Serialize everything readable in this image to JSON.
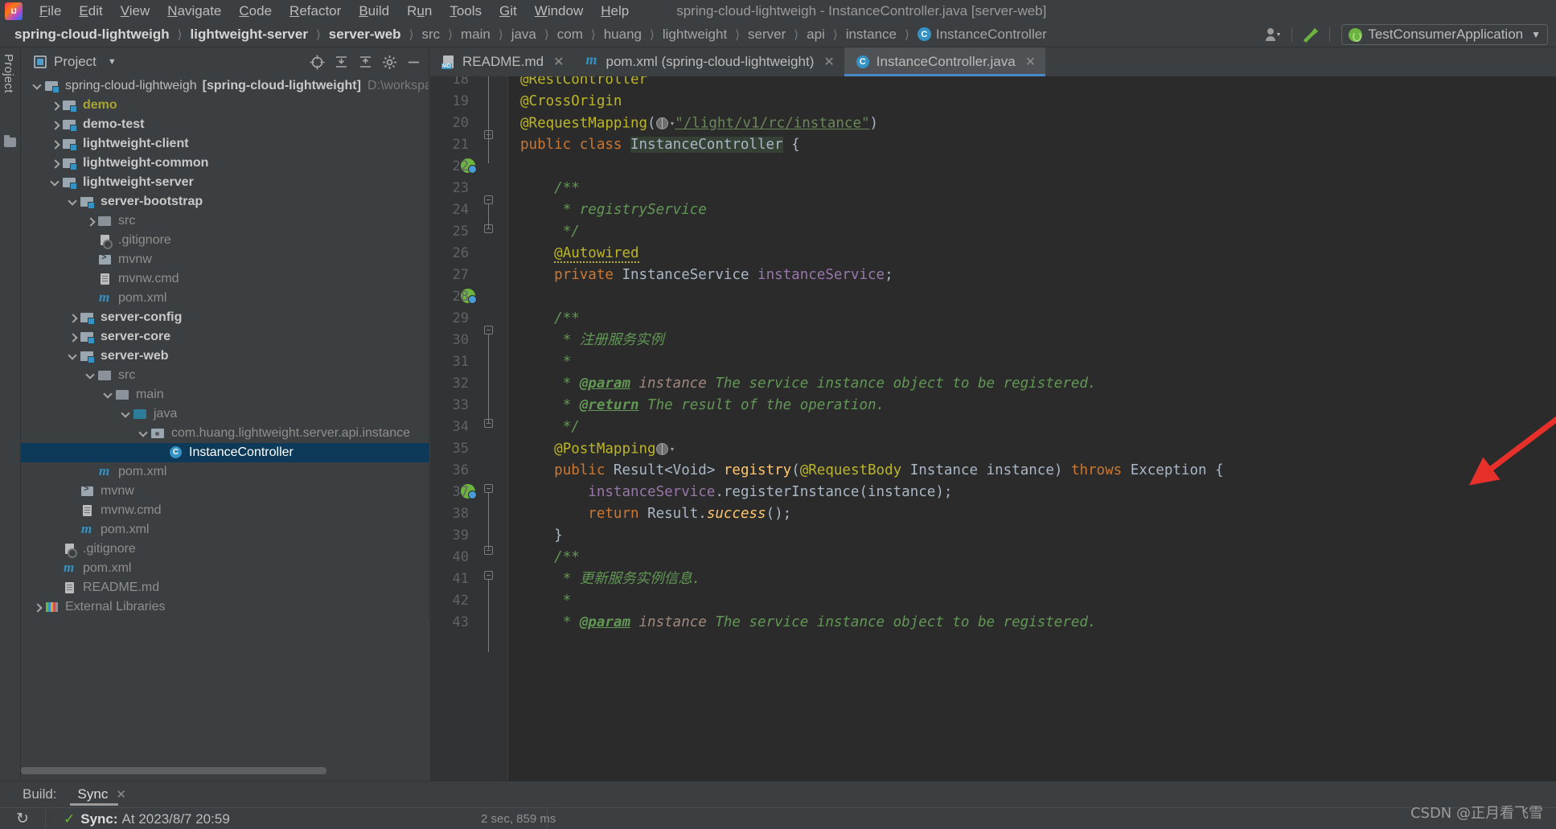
{
  "window": {
    "title": "spring-cloud-lightweigh - InstanceController.java [server-web]"
  },
  "menu": [
    {
      "label": "File",
      "mnemonic": "F"
    },
    {
      "label": "Edit",
      "mnemonic": "E"
    },
    {
      "label": "View",
      "mnemonic": "V"
    },
    {
      "label": "Navigate",
      "mnemonic": "N"
    },
    {
      "label": "Code",
      "mnemonic": "C"
    },
    {
      "label": "Refactor",
      "mnemonic": "R"
    },
    {
      "label": "Build",
      "mnemonic": "B"
    },
    {
      "label": "Run",
      "mnemonic": "u"
    },
    {
      "label": "Tools",
      "mnemonic": "T"
    },
    {
      "label": "Git",
      "mnemonic": "G"
    },
    {
      "label": "Window",
      "mnemonic": "W"
    },
    {
      "label": "Help",
      "mnemonic": "H"
    }
  ],
  "breadcrumb": [
    {
      "label": "spring-cloud-lightweigh",
      "style": "bold"
    },
    {
      "label": "lightweight-server",
      "style": "bold"
    },
    {
      "label": "server-web",
      "style": "bold"
    },
    {
      "label": "src",
      "style": "plain"
    },
    {
      "label": "main",
      "style": "plain"
    },
    {
      "label": "java",
      "style": "plain"
    },
    {
      "label": "com",
      "style": "plain"
    },
    {
      "label": "huang",
      "style": "plain"
    },
    {
      "label": "lightweight",
      "style": "plain"
    },
    {
      "label": "server",
      "style": "plain"
    },
    {
      "label": "api",
      "style": "plain"
    },
    {
      "label": "instance",
      "style": "plain"
    },
    {
      "label": "InstanceController",
      "style": "class"
    }
  ],
  "toolbar": {
    "user_icon": "user-icon",
    "hammer_icon": "build-hammer-icon",
    "run_config": "TestConsumerApplication"
  },
  "project_panel": {
    "tool_window_label": "Project",
    "title": "Project",
    "actions": [
      "locate-icon",
      "collapse-all-icon",
      "expand-all-icon",
      "settings-icon",
      "hide-icon"
    ],
    "tree": [
      {
        "depth": 0,
        "arrow": "down",
        "icon": "module",
        "label": "spring-cloud-lightweigh",
        "suffix": "[spring-cloud-lightweight]",
        "path": "D:\\workspac",
        "style": "normal"
      },
      {
        "depth": 1,
        "arrow": "right",
        "icon": "module",
        "label": "demo",
        "style": "demo"
      },
      {
        "depth": 1,
        "arrow": "right",
        "icon": "module",
        "label": "demo-test",
        "style": "bold"
      },
      {
        "depth": 1,
        "arrow": "right",
        "icon": "module",
        "label": "lightweight-client",
        "style": "bold"
      },
      {
        "depth": 1,
        "arrow": "right",
        "icon": "module",
        "label": "lightweight-common",
        "style": "bold"
      },
      {
        "depth": 1,
        "arrow": "down",
        "icon": "module",
        "label": "lightweight-server",
        "style": "bold"
      },
      {
        "depth": 2,
        "arrow": "down",
        "icon": "module",
        "label": "server-bootstrap",
        "style": "bold"
      },
      {
        "depth": 3,
        "arrow": "right",
        "icon": "folder",
        "label": "src",
        "style": "dim"
      },
      {
        "depth": 3,
        "arrow": "none",
        "icon": "gitignore",
        "label": ".gitignore",
        "style": "dim"
      },
      {
        "depth": 3,
        "arrow": "none",
        "icon": "script",
        "label": "mvnw",
        "style": "dim"
      },
      {
        "depth": 3,
        "arrow": "none",
        "icon": "file",
        "label": "mvnw.cmd",
        "style": "dim"
      },
      {
        "depth": 3,
        "arrow": "none",
        "icon": "maven",
        "label": "pom.xml",
        "style": "dim"
      },
      {
        "depth": 2,
        "arrow": "right",
        "icon": "module",
        "label": "server-config",
        "style": "bold"
      },
      {
        "depth": 2,
        "arrow": "right",
        "icon": "module",
        "label": "server-core",
        "style": "bold"
      },
      {
        "depth": 2,
        "arrow": "down",
        "icon": "module",
        "label": "server-web",
        "style": "bold"
      },
      {
        "depth": 3,
        "arrow": "down",
        "icon": "folder",
        "label": "src",
        "style": "dim"
      },
      {
        "depth": 4,
        "arrow": "down",
        "icon": "folder",
        "label": "main",
        "style": "dim"
      },
      {
        "depth": 5,
        "arrow": "down",
        "icon": "srcfolder",
        "label": "java",
        "style": "dim"
      },
      {
        "depth": 6,
        "arrow": "down",
        "icon": "package",
        "label": "com.huang.lightweight.server.api.instance",
        "style": "dim"
      },
      {
        "depth": 7,
        "arrow": "none",
        "icon": "classico",
        "label": "InstanceController",
        "style": "dim",
        "selected": true
      },
      {
        "depth": 3,
        "arrow": "none",
        "icon": "maven",
        "label": "pom.xml",
        "style": "dim"
      },
      {
        "depth": 2,
        "arrow": "none",
        "icon": "script",
        "label": "mvnw",
        "style": "dim"
      },
      {
        "depth": 2,
        "arrow": "none",
        "icon": "file",
        "label": "mvnw.cmd",
        "style": "dim"
      },
      {
        "depth": 2,
        "arrow": "none",
        "icon": "maven",
        "label": "pom.xml",
        "style": "dim"
      },
      {
        "depth": 1,
        "arrow": "none",
        "icon": "gitignore",
        "label": ".gitignore",
        "style": "dim"
      },
      {
        "depth": 1,
        "arrow": "none",
        "icon": "maven",
        "label": "pom.xml",
        "style": "dim"
      },
      {
        "depth": 1,
        "arrow": "none",
        "icon": "file",
        "label": "README.md",
        "style": "dim"
      },
      {
        "depth": 0,
        "arrow": "right",
        "icon": "libs",
        "label": "External Libraries",
        "style": "dim"
      }
    ]
  },
  "editor": {
    "tabs": [
      {
        "label": "README.md",
        "icon": "markdown-icon",
        "active": false
      },
      {
        "label": "pom.xml (spring-cloud-lightweight)",
        "icon": "maven-icon",
        "active": false
      },
      {
        "label": "InstanceController.java",
        "icon": "class-icon",
        "active": true
      }
    ],
    "first_visible_line": 18,
    "lines": [
      {
        "num": 18,
        "text": "@RestController",
        "clipped_top": true
      },
      {
        "num": 19,
        "text": "@CrossOrigin"
      },
      {
        "num": 20,
        "text": "@RequestMapping(\"/light/v1/rc/instance\")"
      },
      {
        "num": 21,
        "text": "public class InstanceController {",
        "gutter": "spring-bean"
      },
      {
        "num": 22,
        "text": ""
      },
      {
        "num": 23,
        "text": "    /**"
      },
      {
        "num": 24,
        "text": "     * registryService"
      },
      {
        "num": 25,
        "text": "     */"
      },
      {
        "num": 26,
        "text": "    @Autowired"
      },
      {
        "num": 27,
        "text": "    private InstanceService instanceService;",
        "gutter": "spring-bean-arrow"
      },
      {
        "num": 28,
        "text": ""
      },
      {
        "num": 29,
        "text": "    /**"
      },
      {
        "num": 30,
        "text": "     * 注册服务实例"
      },
      {
        "num": 31,
        "text": "     *"
      },
      {
        "num": 32,
        "text": "     * @param instance The service instance object to be registered."
      },
      {
        "num": 33,
        "text": "     * @return The result of the operation."
      },
      {
        "num": 34,
        "text": "     */"
      },
      {
        "num": 35,
        "text": "    @PostMapping"
      },
      {
        "num": 36,
        "text": "    public Result<Void> registry(@RequestBody Instance instance) throws Exception {",
        "gutter": "spring-bean"
      },
      {
        "num": 37,
        "text": "        instanceService.registerInstance(instance);"
      },
      {
        "num": 38,
        "text": "        return Result.success();"
      },
      {
        "num": 39,
        "text": "    }"
      },
      {
        "num": 40,
        "text": "    /**"
      },
      {
        "num": 41,
        "text": "     * 更新服务实例信息."
      },
      {
        "num": 42,
        "text": "     *"
      },
      {
        "num": 43,
        "text": "     * @param instance The service instance object to be registered."
      }
    ],
    "mapping_url": "/light/v1/rc/instance",
    "selected_identifier": "InstanceController"
  },
  "build_panel": {
    "label": "Build:",
    "tab": "Sync",
    "status": "Sync:",
    "status_detail": "At 2023/8/7 20:59",
    "duration": "2 sec, 859 ms"
  },
  "watermark": "CSDN @正月看飞雪",
  "colors": {
    "accent_blue": "#3592c4",
    "selection_blue": "#0d3a58",
    "editor_bg": "#2b2b2b",
    "panel_bg": "#3c3f41",
    "annotation_red": "#e8302a",
    "keyword_orange": "#cc7832",
    "comment_green": "#629755",
    "annotation_yellow": "#bbb529"
  }
}
